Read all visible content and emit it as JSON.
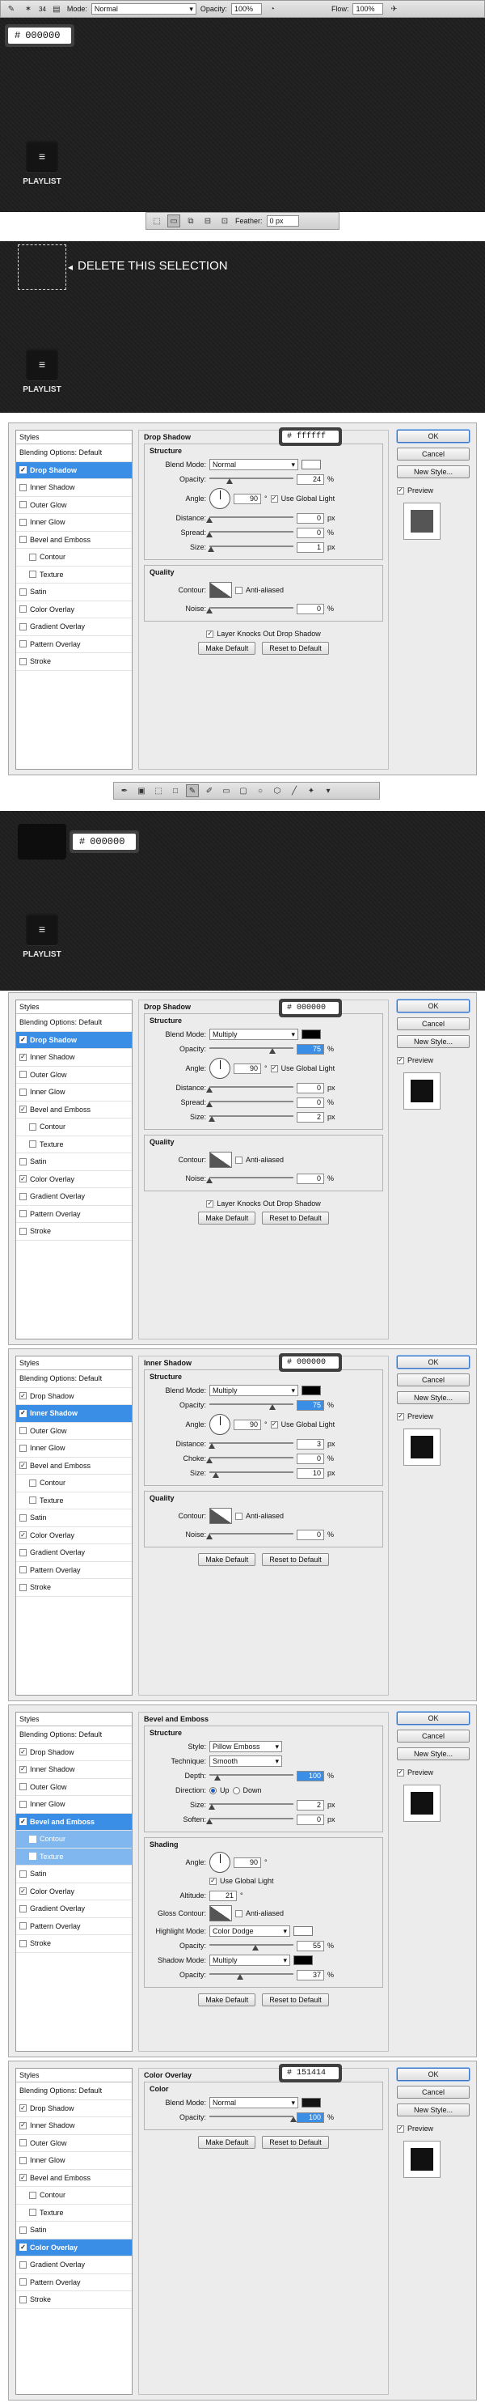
{
  "toolbar1": {
    "mode_label": "Mode:",
    "mode_value": "Normal",
    "opacity_label": "Opacity:",
    "opacity_value": "100%",
    "flow_label": "Flow:",
    "flow_value": "100%",
    "brush_size": "34"
  },
  "hex": {
    "s1": "000000",
    "s2": "ffffff",
    "s3": "000000",
    "s4": "000000",
    "s5": "000000",
    "s6": "151414"
  },
  "hash": "#",
  "playlist_label": "PLAYLIST",
  "play_icon": "≡",
  "toolbar2": {
    "feather_label": "Feather:",
    "feather_value": "0 px"
  },
  "delete_note": "DELETE THIS SELECTION",
  "styles_header": "Styles",
  "blending_item": "Blending Options: Default",
  "style_items": [
    "Drop Shadow",
    "Inner Shadow",
    "Outer Glow",
    "Inner Glow",
    "Bevel and Emboss",
    "Contour",
    "Texture",
    "Satin",
    "Color Overlay",
    "Gradient Overlay",
    "Pattern Overlay",
    "Stroke"
  ],
  "buttons": {
    "ok": "OK",
    "cancel": "Cancel",
    "new_style": "New Style...",
    "preview": "Preview",
    "make_default": "Make Default",
    "reset_default": "Reset to Default"
  },
  "labels": {
    "structure": "Structure",
    "quality": "Quality",
    "blend_mode": "Blend Mode:",
    "opacity": "Opacity:",
    "angle": "Angle:",
    "use_global": "Use Global Light",
    "distance": "Distance:",
    "spread": "Spread:",
    "choke": "Choke:",
    "size": "Size:",
    "contour": "Contour:",
    "anti_aliased": "Anti-aliased",
    "noise": "Noise:",
    "layer_knocks": "Layer Knocks Out Drop Shadow",
    "px": "px",
    "pct": "%",
    "deg": "°",
    "style": "Style:",
    "technique": "Technique:",
    "depth": "Depth:",
    "direction": "Direction:",
    "up": "Up",
    "down": "Down",
    "soften": "Soften:",
    "shading": "Shading",
    "altitude": "Altitude:",
    "gloss_contour": "Gloss Contour:",
    "highlight_mode": "Highlight Mode:",
    "shadow_mode": "Shadow Mode:",
    "color": "Color"
  },
  "p1": {
    "title": "Drop Shadow",
    "blend": "Normal",
    "opacity": "24",
    "angle": "90",
    "distance": "0",
    "spread": "0",
    "size": "1",
    "noise": "0",
    "swatch": "#ffffff",
    "preview": "#555555"
  },
  "p2": {
    "title": "Drop Shadow",
    "blend": "Multiply",
    "opacity": "75",
    "angle": "90",
    "distance": "0",
    "spread": "0",
    "size": "2",
    "noise": "0",
    "swatch": "#000000",
    "preview": "#111111"
  },
  "p3": {
    "title": "Inner Shadow",
    "blend": "Multiply",
    "opacity": "75",
    "angle": "90",
    "distance": "3",
    "choke": "0",
    "size": "10",
    "noise": "0",
    "swatch": "#000000",
    "preview": "#111111"
  },
  "p4": {
    "title": "Bevel and Emboss",
    "style": "Pillow Emboss",
    "technique": "Smooth",
    "depth": "100",
    "size": "2",
    "soften": "0",
    "angle": "90",
    "altitude": "21",
    "highlight": "Color Dodge",
    "highlight_opacity": "55",
    "shadow": "Multiply",
    "shadow_opacity": "37",
    "hl_swatch": "#ffffff",
    "sh_swatch": "#000000",
    "preview": "#111111"
  },
  "p5": {
    "title": "Color Overlay",
    "blend": "Normal",
    "opacity": "100",
    "swatch": "#151414",
    "preview": "#111111"
  }
}
